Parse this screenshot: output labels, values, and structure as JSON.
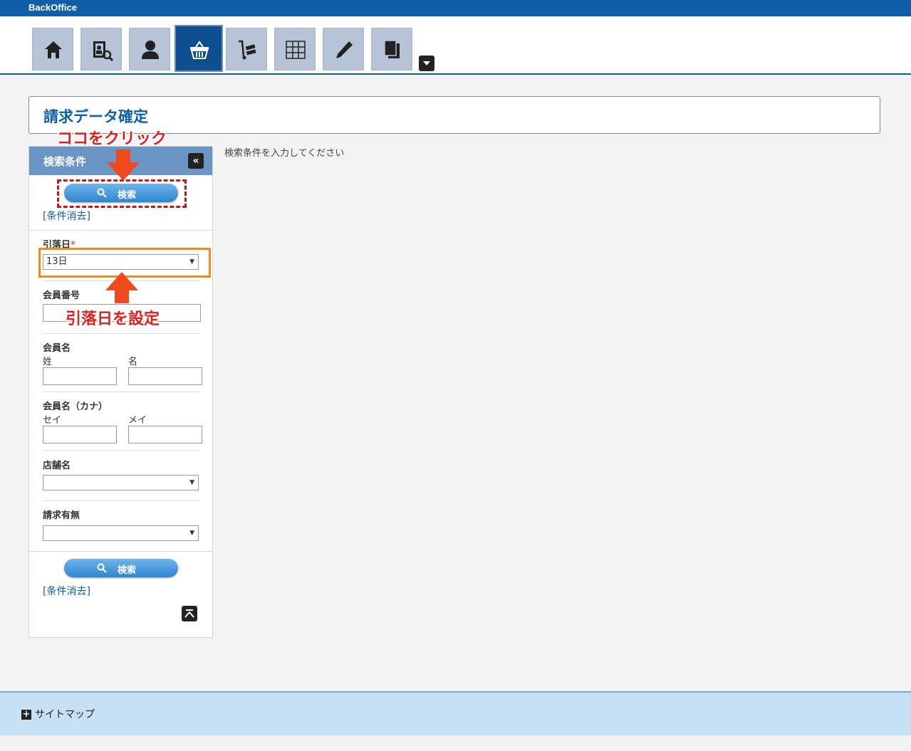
{
  "app": {
    "brand": "BackOffice"
  },
  "nav": {
    "icons": [
      "home-icon",
      "member-search-icon",
      "user-icon",
      "basket-icon",
      "cart-icon",
      "grid-icon",
      "pencil-icon",
      "documents-icon"
    ],
    "active": "basket-icon"
  },
  "page": {
    "title": "請求データ確定",
    "hint": "検索条件を入力してください"
  },
  "panel": {
    "header": "検索条件",
    "search_label": "検索",
    "clear_label": "[条件消去]",
    "fields": {
      "withdrawal_day": {
        "label": "引落日",
        "required_mark": "*",
        "value": "13日"
      },
      "member_number": {
        "label": "会員番号",
        "value": ""
      },
      "member_name": {
        "label": "会員名",
        "last_label": "姓",
        "first_label": "名"
      },
      "member_kana": {
        "label": "会員名（カナ）",
        "last_label": "セイ",
        "first_label": "メイ"
      },
      "store_name": {
        "label": "店舗名",
        "value": ""
      },
      "billing_status": {
        "label": "請求有無",
        "value": ""
      }
    }
  },
  "annotations": {
    "click_here": "ココをクリック",
    "set_day": "引落日を設定"
  },
  "footer": {
    "sitemap": "サイトマップ"
  },
  "colors": {
    "brand_blue": "#0e5fa8",
    "annotation_red": "#e02020",
    "highlight_orange": "#f08a1c"
  }
}
